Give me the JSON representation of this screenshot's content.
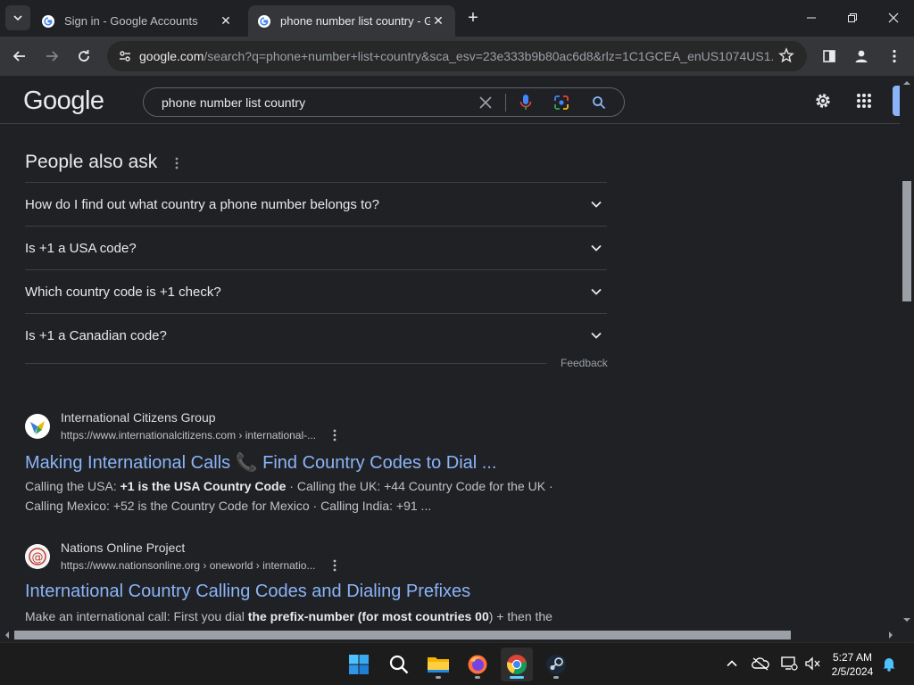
{
  "browser": {
    "tabs": [
      {
        "title": "Sign in - Google Accounts",
        "active": false
      },
      {
        "title": "phone number list country - Go",
        "active": true
      }
    ],
    "url_host": "google.com",
    "url_rest": "/search?q=phone+number+list+country&sca_esv=23e333b9b80ac6d8&rlz=1C1GCEA_enUS1074US1..."
  },
  "google": {
    "logo": "Google",
    "query": "phone number list country"
  },
  "people_also_ask": {
    "title": "People also ask",
    "questions": [
      "How do I find out what country a phone number belongs to?",
      "Is +1 a USA code?",
      "Which country code is +1 check?",
      "Is +1 a Canadian code?"
    ],
    "feedback": "Feedback"
  },
  "results": [
    {
      "site_name": "International Citizens Group",
      "url": "https://www.internationalcitizens.com › international-...",
      "title": "Making International Calls 📞 Find Country Codes to Dial ...",
      "snippet_pre": "Calling the USA: ",
      "snippet_bold": "+1 is the USA Country Code",
      "snippet_post": " · Calling the UK: +44 Country Code for the UK · Calling Mexico: +52 is the Country Code for Mexico · Calling India: +91 ..."
    },
    {
      "site_name": "Nations Online Project",
      "url": "https://www.nationsonline.org › oneworld › internatio...",
      "title": "International Country Calling Codes and Dialing Prefixes",
      "snippet_pre": "Make an international call: First you dial ",
      "snippet_bold": "the prefix-number (for most countries 00",
      "snippet_post": ") + then the"
    }
  ],
  "taskbar": {
    "apps": [
      "windows-start",
      "search",
      "file-explorer",
      "firefox",
      "chrome",
      "steam"
    ],
    "time": "5:27 AM",
    "date": "2/5/2024"
  },
  "colors": {
    "link": "#8ab4f8",
    "background": "#202124",
    "toolbar": "#35363a"
  }
}
